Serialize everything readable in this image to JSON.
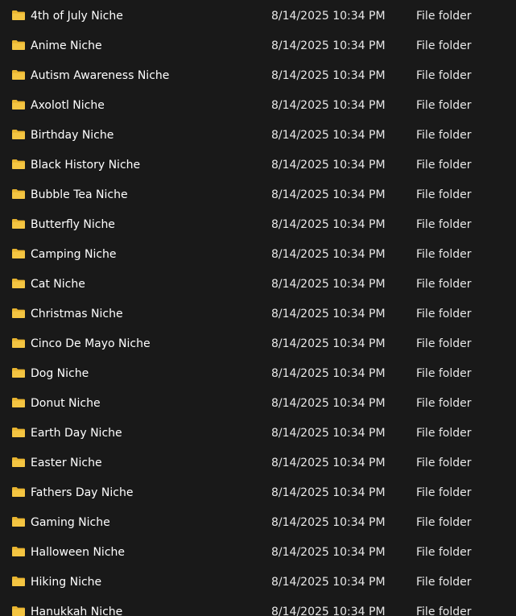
{
  "file_list": {
    "rows": [
      {
        "name": "4th of July Niche",
        "date_modified": "8/14/2025 10:34 PM",
        "type": "File folder",
        "icon": "folder-icon"
      },
      {
        "name": "Anime Niche",
        "date_modified": "8/14/2025 10:34 PM",
        "type": "File folder",
        "icon": "folder-icon"
      },
      {
        "name": "Autism Awareness Niche",
        "date_modified": "8/14/2025 10:34 PM",
        "type": "File folder",
        "icon": "folder-icon"
      },
      {
        "name": "Axolotl Niche",
        "date_modified": "8/14/2025 10:34 PM",
        "type": "File folder",
        "icon": "folder-icon"
      },
      {
        "name": "Birthday Niche",
        "date_modified": "8/14/2025 10:34 PM",
        "type": "File folder",
        "icon": "folder-icon"
      },
      {
        "name": "Black History Niche",
        "date_modified": "8/14/2025 10:34 PM",
        "type": "File folder",
        "icon": "folder-icon"
      },
      {
        "name": "Bubble Tea Niche",
        "date_modified": "8/14/2025 10:34 PM",
        "type": "File folder",
        "icon": "folder-icon"
      },
      {
        "name": "Butterfly Niche",
        "date_modified": "8/14/2025 10:34 PM",
        "type": "File folder",
        "icon": "folder-icon"
      },
      {
        "name": "Camping Niche",
        "date_modified": "8/14/2025 10:34 PM",
        "type": "File folder",
        "icon": "folder-icon"
      },
      {
        "name": "Cat Niche",
        "date_modified": "8/14/2025 10:34 PM",
        "type": "File folder",
        "icon": "folder-icon"
      },
      {
        "name": "Christmas Niche",
        "date_modified": "8/14/2025 10:34 PM",
        "type": "File folder",
        "icon": "folder-icon"
      },
      {
        "name": "Cinco De Mayo Niche",
        "date_modified": "8/14/2025 10:34 PM",
        "type": "File folder",
        "icon": "folder-icon"
      },
      {
        "name": "Dog Niche",
        "date_modified": "8/14/2025 10:34 PM",
        "type": "File folder",
        "icon": "folder-icon"
      },
      {
        "name": "Donut Niche",
        "date_modified": "8/14/2025 10:34 PM",
        "type": "File folder",
        "icon": "folder-icon"
      },
      {
        "name": "Earth Day Niche",
        "date_modified": "8/14/2025 10:34 PM",
        "type": "File folder",
        "icon": "folder-icon"
      },
      {
        "name": "Easter Niche",
        "date_modified": "8/14/2025 10:34 PM",
        "type": "File folder",
        "icon": "folder-icon"
      },
      {
        "name": "Fathers Day Niche",
        "date_modified": "8/14/2025 10:34 PM",
        "type": "File folder",
        "icon": "folder-icon"
      },
      {
        "name": "Gaming Niche",
        "date_modified": "8/14/2025 10:34 PM",
        "type": "File folder",
        "icon": "folder-icon"
      },
      {
        "name": "Halloween Niche",
        "date_modified": "8/14/2025 10:34 PM",
        "type": "File folder",
        "icon": "folder-icon"
      },
      {
        "name": "Hiking Niche",
        "date_modified": "8/14/2025 10:34 PM",
        "type": "File folder",
        "icon": "folder-icon"
      },
      {
        "name": "Hanukkah Niche",
        "date_modified": "8/14/2025 10:34 PM",
        "type": "File folder",
        "icon": "folder-icon"
      }
    ]
  },
  "colors": {
    "background": "#191919",
    "text": "#ffffff",
    "folder_icon": "#f4c542"
  }
}
